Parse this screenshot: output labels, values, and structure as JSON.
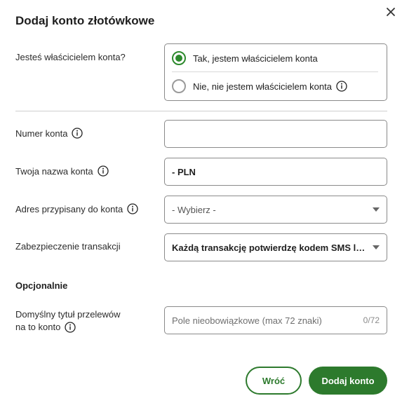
{
  "dialog": {
    "title": "Dodaj konto złotówkowe"
  },
  "owner": {
    "label": "Jesteś właścicielem konta?",
    "options": [
      {
        "label": "Tak, jestem właścicielem konta",
        "checked": true
      },
      {
        "label": "Nie, nie jestem właścicielem konta",
        "checked": false
      }
    ]
  },
  "account_number": {
    "label": "Numer konta",
    "value": ""
  },
  "account_name": {
    "label": "Twoja nazwa konta",
    "value": "- PLN"
  },
  "address": {
    "label": "Adres przypisany do konta",
    "selected": "- Wybierz -"
  },
  "security": {
    "label": "Zabezpieczenie transakcji",
    "selected": "Każdą transakcję potwierdzę kodem SMS lub w aplikacji mobilnej"
  },
  "optional": {
    "heading": "Opcjonalnie",
    "default_title_label_line1": "Domyślny tytuł przelewów",
    "default_title_label_line2": "na to konto",
    "placeholder": "Pole nieobowiązkowe (max 72 znaki)",
    "counter": "0/72"
  },
  "buttons": {
    "back": "Wróć",
    "add": "Dodaj konto"
  },
  "colors": {
    "accent": "#2d7a2d",
    "radio_checked": "#2d8a2d",
    "border": "#8a8a8a"
  },
  "icons": {
    "close": "close-icon",
    "info": "info-icon",
    "chevron": "chevron-down-icon"
  }
}
